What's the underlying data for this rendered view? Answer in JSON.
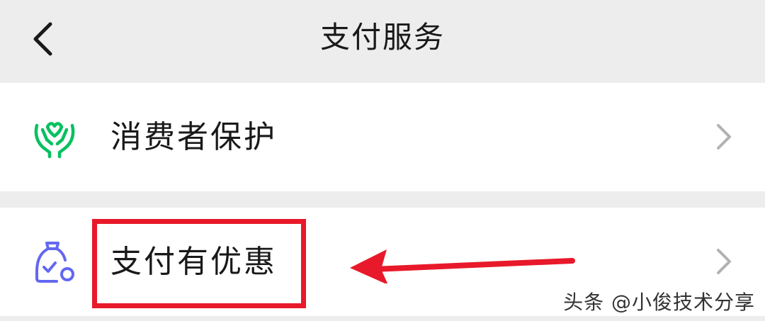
{
  "header": {
    "title": "支付服务",
    "back_icon": "chevron-left-icon"
  },
  "menu": {
    "items": [
      {
        "label": "消费者保护",
        "icon": "hands-shield-icon",
        "icon_color": "#07c160"
      },
      {
        "label": "支付有优惠",
        "icon": "discount-bag-icon",
        "icon_color": "#6467f0"
      }
    ]
  },
  "annotation": {
    "highlight_color": "#e8192a",
    "arrow_color": "#e8192a"
  },
  "watermark": {
    "text": "头条 @小俊技术分享"
  },
  "colors": {
    "background": "#ededed",
    "row_background": "#ffffff",
    "text": "#191919",
    "chevron": "#b2b2b2"
  }
}
